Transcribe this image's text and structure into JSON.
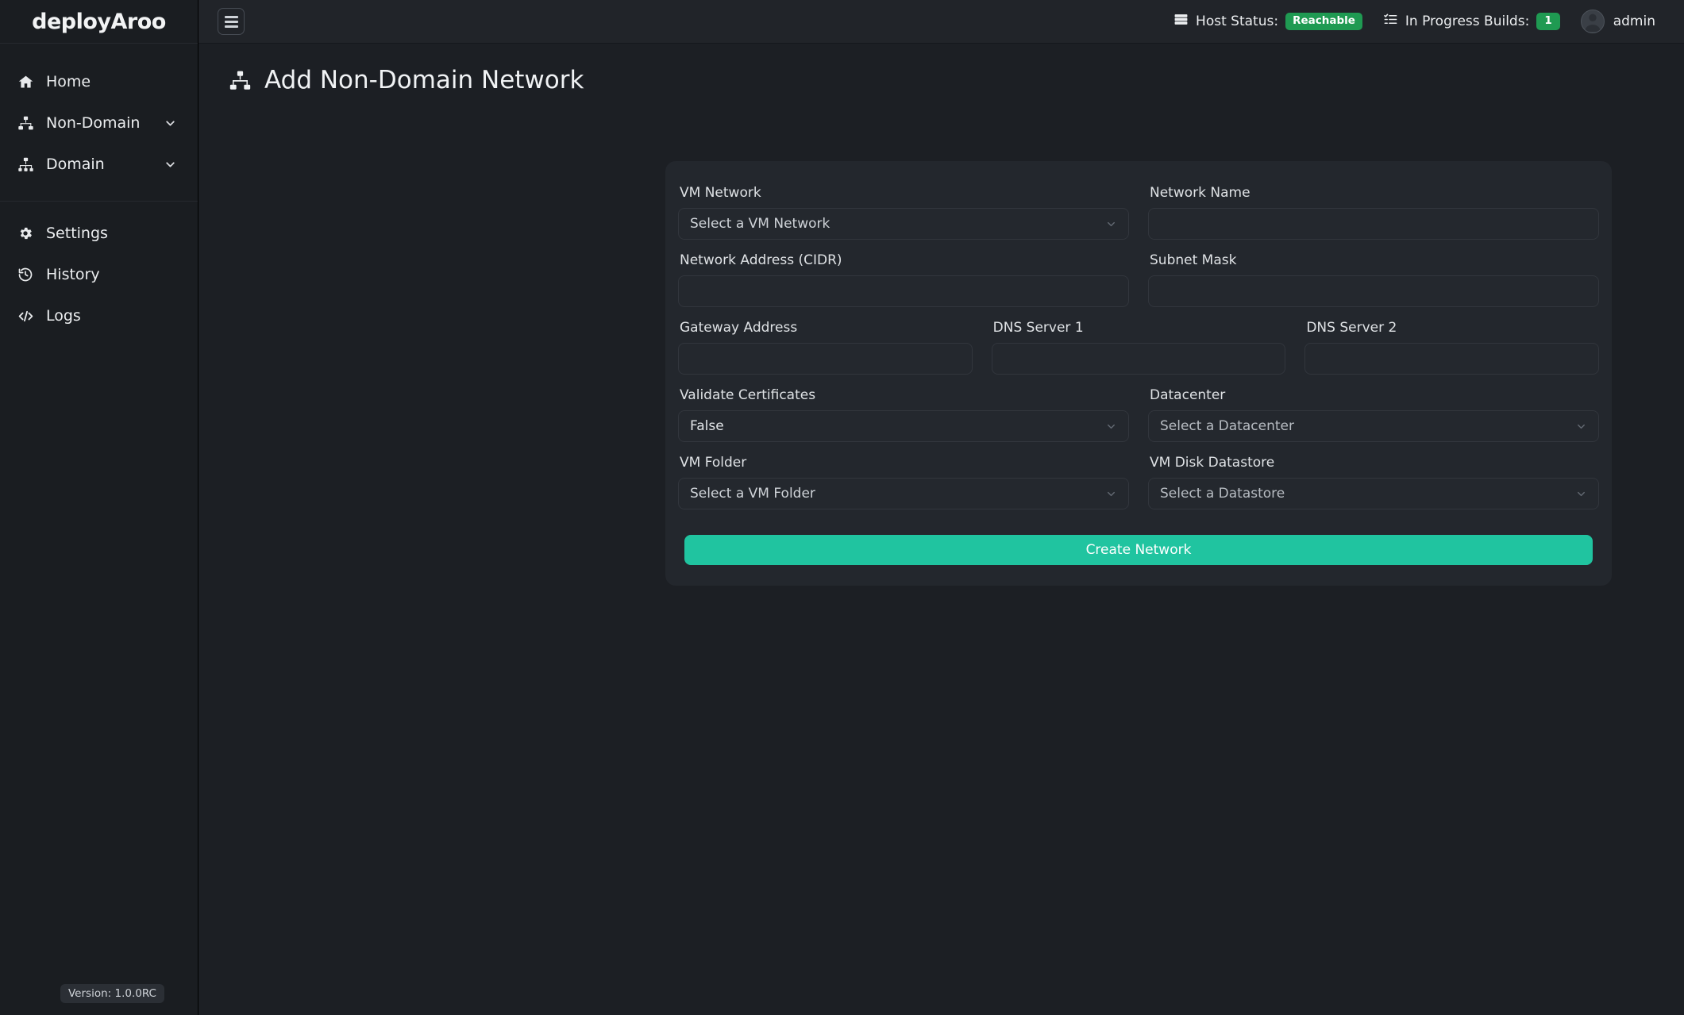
{
  "brand": {
    "name": "deployAroo"
  },
  "sidebar": {
    "items": [
      {
        "label": "Home",
        "icon": "home-icon",
        "expandable": false
      },
      {
        "label": "Non-Domain",
        "icon": "sitemap-two-icon",
        "expandable": true
      },
      {
        "label": "Domain",
        "icon": "sitemap-three-icon",
        "expandable": true
      }
    ],
    "items_secondary": [
      {
        "label": "Settings",
        "icon": "gear-icon"
      },
      {
        "label": "History",
        "icon": "clock-rotate-left-icon"
      },
      {
        "label": "Logs",
        "icon": "code-icon"
      }
    ],
    "version": "Version: 1.0.0RC"
  },
  "topbar": {
    "menu_toggle": "hamburger-icon",
    "host_status_label": "Host Status:",
    "host_status_value": "Reachable",
    "builds_label": "In Progress Builds:",
    "builds_count": "1",
    "user": "admin"
  },
  "page": {
    "title": "Add Non-Domain Network",
    "title_icon": "sitemap-icon"
  },
  "form": {
    "vm_network": {
      "label": "VM Network",
      "value": "Select a VM Network",
      "type": "select"
    },
    "network_name": {
      "label": "Network Name",
      "value": "",
      "placeholder": "",
      "type": "input"
    },
    "network_address": {
      "label": "Network Address (CIDR)",
      "value": "",
      "placeholder": "",
      "type": "input"
    },
    "subnet_mask": {
      "label": "Subnet Mask",
      "value": "",
      "placeholder": "",
      "type": "input"
    },
    "gateway_address": {
      "label": "Gateway Address",
      "value": "",
      "placeholder": "",
      "type": "input"
    },
    "dns_server_1": {
      "label": "DNS Server 1",
      "value": "",
      "placeholder": "",
      "type": "input"
    },
    "dns_server_2": {
      "label": "DNS Server 2",
      "value": "",
      "placeholder": "",
      "type": "input"
    },
    "validate_certificates": {
      "label": "Validate Certificates",
      "value": "False",
      "type": "select"
    },
    "datacenter": {
      "label": "Datacenter",
      "value": "Select a Datacenter",
      "type": "select"
    },
    "vm_folder": {
      "label": "VM Folder",
      "value": "Select a VM Folder",
      "type": "select"
    },
    "vm_disk_datastore": {
      "label": "VM Disk Datastore",
      "value": "Select a Datastore",
      "type": "select"
    },
    "submit_label": "Create Network"
  },
  "colors": {
    "accent": "#20c4a0",
    "status_green": "#1f9a52",
    "page_bg": "#1c1f24",
    "card_bg": "#23272d"
  }
}
